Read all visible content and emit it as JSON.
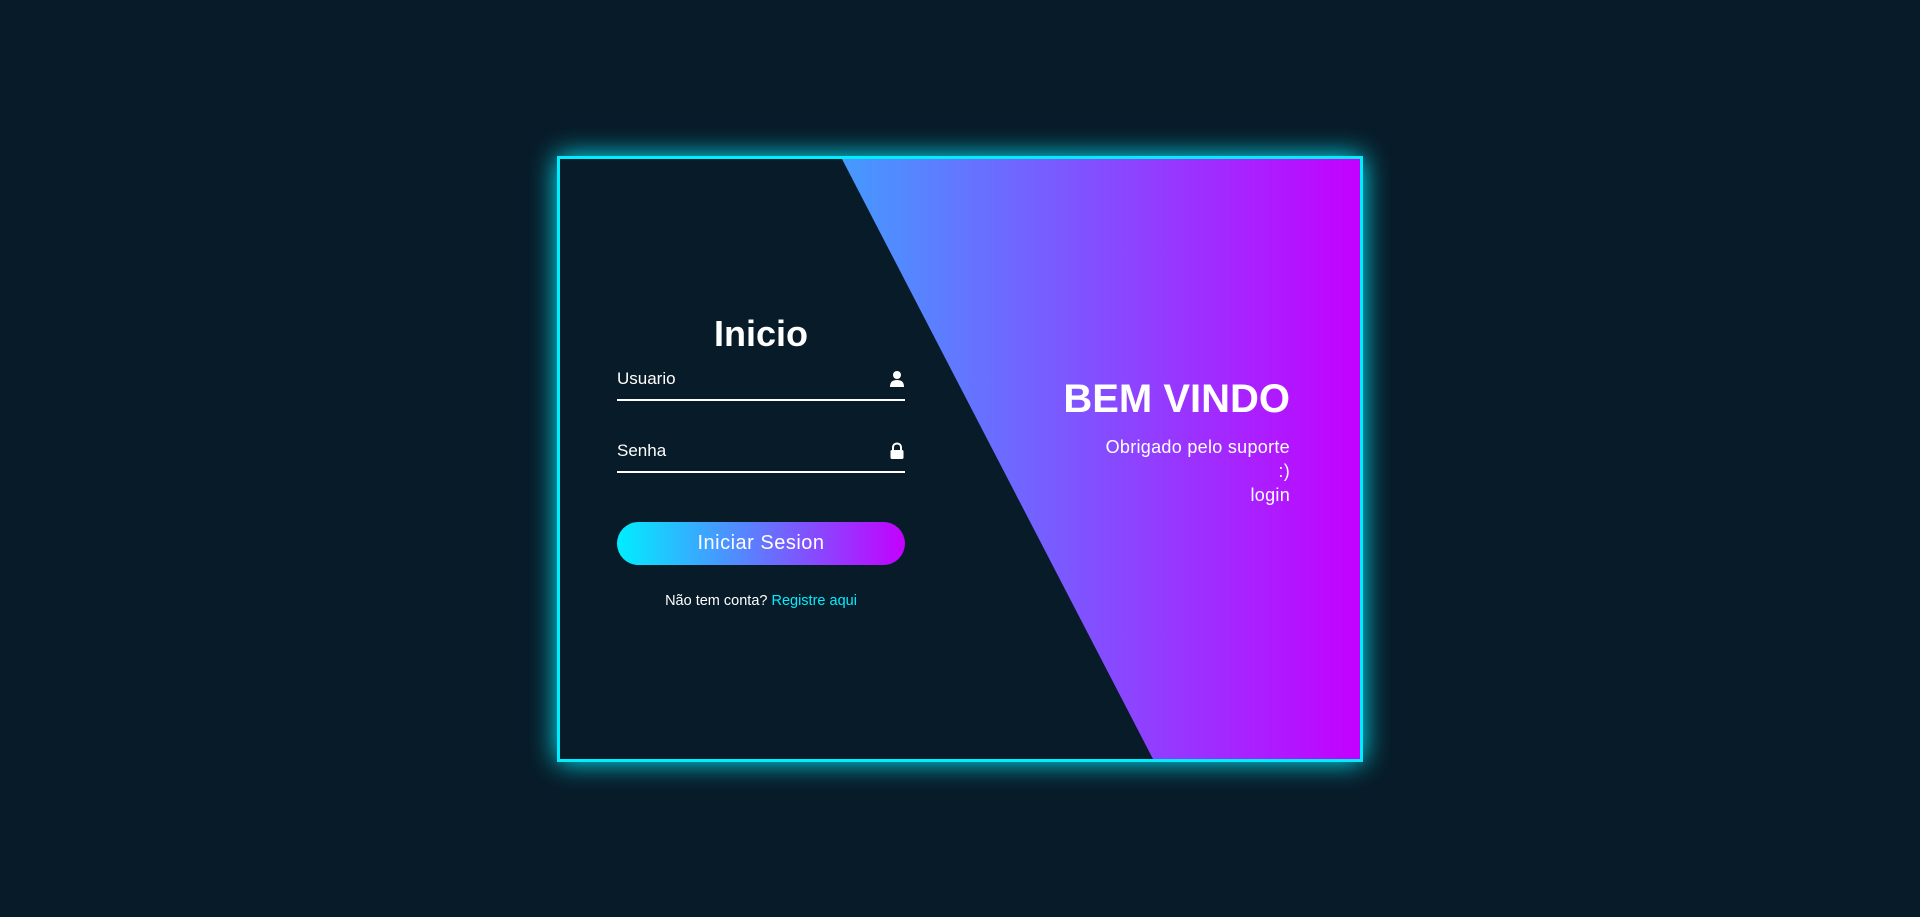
{
  "form": {
    "title": "Inicio",
    "username_placeholder": "Usuario",
    "password_placeholder": "Senha",
    "submit_label": "Iniciar Sesion",
    "register_prompt": "Não tem conta?",
    "register_link": "Registre aqui",
    "username_icon": "user-icon",
    "password_icon": "lock-icon"
  },
  "info": {
    "title": "BEM VINDO",
    "line1": "Obrigado pelo suporte :)",
    "line2": "login"
  },
  "colors": {
    "background": "#081b29",
    "accent_cyan": "#00eeff",
    "accent_purple": "#c400ff",
    "text": "#ffffff"
  }
}
